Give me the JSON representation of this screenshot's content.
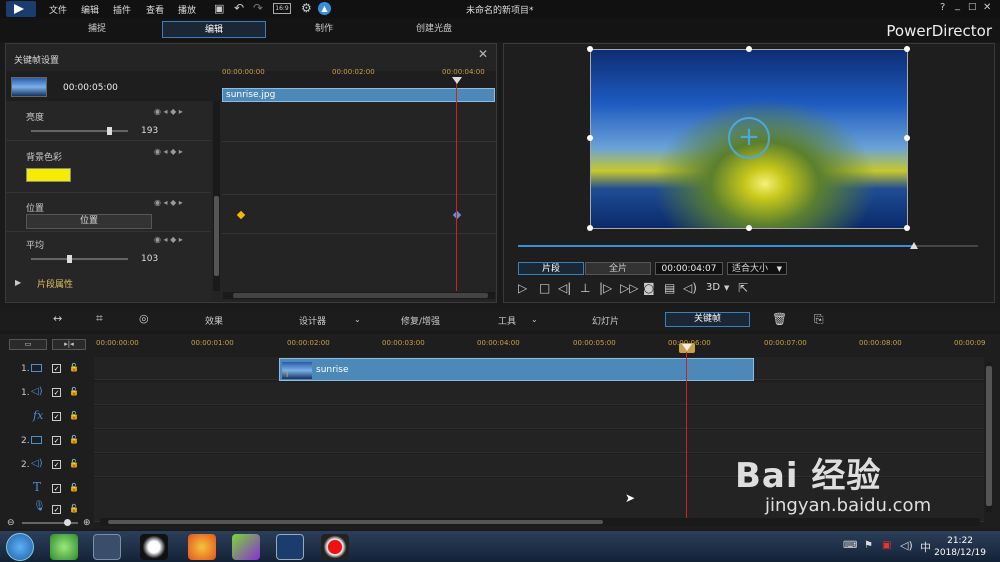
{
  "menu": {
    "items": [
      "文件",
      "编辑",
      "插件",
      "查看",
      "播放"
    ],
    "title": "未命名的新项目*",
    "window_controls": [
      "?",
      "_",
      "□",
      "✕"
    ]
  },
  "modes": {
    "tabs": [
      "捕捉",
      "编辑",
      "制作",
      "创建光盘"
    ],
    "active": "编辑",
    "brand": "PowerDirector"
  },
  "keyframe_panel": {
    "title": "关键帧设置",
    "timecode": "00:00:05:00",
    "ruler": [
      "00:00:00:00",
      "00:00:02:00",
      "00:00:04:00"
    ],
    "clip_name": "sunrise.jpg",
    "properties": {
      "brightness_label": "亮度",
      "brightness_value": "193",
      "bg_color_label": "背景色彩",
      "bg_color": "#f5ec00",
      "position_label": "位置",
      "position_button": "位置",
      "average_label": "平均",
      "average_value": "103"
    },
    "clip_attr_label": "片段属性"
  },
  "preview": {
    "tab_clip": "片段",
    "tab_full": "全片",
    "timecode": "00:00:04:07",
    "fit_label": "适合大小",
    "mode_3d": "3D",
    "progress": 0.86
  },
  "toolbar": {
    "effects": "效果",
    "designer": "设计器",
    "repair": "修复/增强",
    "tools": "工具",
    "slideshow": "幻灯片",
    "keyframe": "关键帧"
  },
  "timeline": {
    "ruler": [
      "00:00:00:00",
      "00:00:01:00",
      "00:00:02:00",
      "00:00:03:00",
      "00:00:04:00",
      "00:00:05:00",
      "00:00:06:00",
      "00:00:07:00",
      "00:00:08:00",
      "00:00:09"
    ],
    "clip_name": "sunrise",
    "tracks": [
      "1.",
      "1.",
      "",
      "2.",
      "2.",
      "",
      ""
    ],
    "fx_label": "fx"
  },
  "taskbar": {
    "time": "21:22",
    "date": "2018/12/19"
  },
  "watermark": {
    "text": "Bai 经验",
    "sub": "jingyan.baidu.com"
  }
}
